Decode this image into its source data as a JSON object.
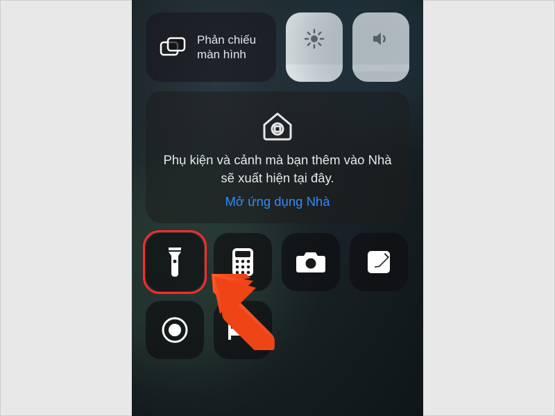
{
  "screen_mirror": {
    "label": "Phản chiếu màn hình"
  },
  "sliders": {
    "brightness_icon": "brightness",
    "volume_icon": "volume"
  },
  "home": {
    "message": "Phụ kiện và cảnh mà bạn thêm vào Nhà sẽ xuất hiện tại đây.",
    "link": "Mở ứng dụng Nhà"
  },
  "controls": [
    {
      "name": "flashlight",
      "highlighted": true
    },
    {
      "name": "calculator",
      "highlighted": false
    },
    {
      "name": "camera",
      "highlighted": false
    },
    {
      "name": "notes",
      "highlighted": false
    },
    {
      "name": "screen-record",
      "highlighted": false
    },
    {
      "name": "sleep",
      "highlighted": false
    }
  ],
  "annotation": {
    "arrow_points_to": "flashlight"
  }
}
